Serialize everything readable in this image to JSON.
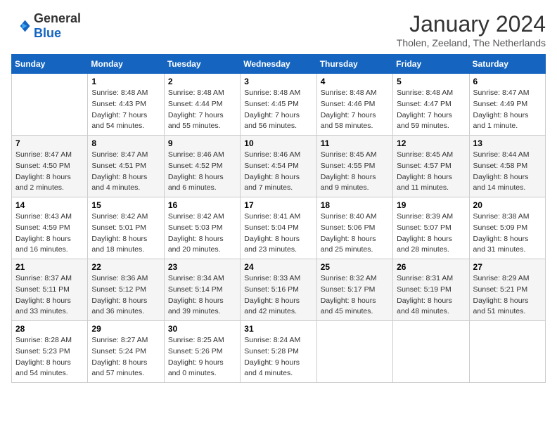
{
  "logo": {
    "text_general": "General",
    "text_blue": "Blue"
  },
  "header": {
    "month": "January 2024",
    "location": "Tholen, Zeeland, The Netherlands"
  },
  "weekdays": [
    "Sunday",
    "Monday",
    "Tuesday",
    "Wednesday",
    "Thursday",
    "Friday",
    "Saturday"
  ],
  "weeks": [
    [
      {
        "day": "",
        "sunrise": "",
        "sunset": "",
        "daylight": ""
      },
      {
        "day": "1",
        "sunrise": "Sunrise: 8:48 AM",
        "sunset": "Sunset: 4:43 PM",
        "daylight": "Daylight: 7 hours and 54 minutes."
      },
      {
        "day": "2",
        "sunrise": "Sunrise: 8:48 AM",
        "sunset": "Sunset: 4:44 PM",
        "daylight": "Daylight: 7 hours and 55 minutes."
      },
      {
        "day": "3",
        "sunrise": "Sunrise: 8:48 AM",
        "sunset": "Sunset: 4:45 PM",
        "daylight": "Daylight: 7 hours and 56 minutes."
      },
      {
        "day": "4",
        "sunrise": "Sunrise: 8:48 AM",
        "sunset": "Sunset: 4:46 PM",
        "daylight": "Daylight: 7 hours and 58 minutes."
      },
      {
        "day": "5",
        "sunrise": "Sunrise: 8:48 AM",
        "sunset": "Sunset: 4:47 PM",
        "daylight": "Daylight: 7 hours and 59 minutes."
      },
      {
        "day": "6",
        "sunrise": "Sunrise: 8:47 AM",
        "sunset": "Sunset: 4:49 PM",
        "daylight": "Daylight: 8 hours and 1 minute."
      }
    ],
    [
      {
        "day": "7",
        "sunrise": "Sunrise: 8:47 AM",
        "sunset": "Sunset: 4:50 PM",
        "daylight": "Daylight: 8 hours and 2 minutes."
      },
      {
        "day": "8",
        "sunrise": "Sunrise: 8:47 AM",
        "sunset": "Sunset: 4:51 PM",
        "daylight": "Daylight: 8 hours and 4 minutes."
      },
      {
        "day": "9",
        "sunrise": "Sunrise: 8:46 AM",
        "sunset": "Sunset: 4:52 PM",
        "daylight": "Daylight: 8 hours and 6 minutes."
      },
      {
        "day": "10",
        "sunrise": "Sunrise: 8:46 AM",
        "sunset": "Sunset: 4:54 PM",
        "daylight": "Daylight: 8 hours and 7 minutes."
      },
      {
        "day": "11",
        "sunrise": "Sunrise: 8:45 AM",
        "sunset": "Sunset: 4:55 PM",
        "daylight": "Daylight: 8 hours and 9 minutes."
      },
      {
        "day": "12",
        "sunrise": "Sunrise: 8:45 AM",
        "sunset": "Sunset: 4:57 PM",
        "daylight": "Daylight: 8 hours and 11 minutes."
      },
      {
        "day": "13",
        "sunrise": "Sunrise: 8:44 AM",
        "sunset": "Sunset: 4:58 PM",
        "daylight": "Daylight: 8 hours and 14 minutes."
      }
    ],
    [
      {
        "day": "14",
        "sunrise": "Sunrise: 8:43 AM",
        "sunset": "Sunset: 4:59 PM",
        "daylight": "Daylight: 8 hours and 16 minutes."
      },
      {
        "day": "15",
        "sunrise": "Sunrise: 8:42 AM",
        "sunset": "Sunset: 5:01 PM",
        "daylight": "Daylight: 8 hours and 18 minutes."
      },
      {
        "day": "16",
        "sunrise": "Sunrise: 8:42 AM",
        "sunset": "Sunset: 5:03 PM",
        "daylight": "Daylight: 8 hours and 20 minutes."
      },
      {
        "day": "17",
        "sunrise": "Sunrise: 8:41 AM",
        "sunset": "Sunset: 5:04 PM",
        "daylight": "Daylight: 8 hours and 23 minutes."
      },
      {
        "day": "18",
        "sunrise": "Sunrise: 8:40 AM",
        "sunset": "Sunset: 5:06 PM",
        "daylight": "Daylight: 8 hours and 25 minutes."
      },
      {
        "day": "19",
        "sunrise": "Sunrise: 8:39 AM",
        "sunset": "Sunset: 5:07 PM",
        "daylight": "Daylight: 8 hours and 28 minutes."
      },
      {
        "day": "20",
        "sunrise": "Sunrise: 8:38 AM",
        "sunset": "Sunset: 5:09 PM",
        "daylight": "Daylight: 8 hours and 31 minutes."
      }
    ],
    [
      {
        "day": "21",
        "sunrise": "Sunrise: 8:37 AM",
        "sunset": "Sunset: 5:11 PM",
        "daylight": "Daylight: 8 hours and 33 minutes."
      },
      {
        "day": "22",
        "sunrise": "Sunrise: 8:36 AM",
        "sunset": "Sunset: 5:12 PM",
        "daylight": "Daylight: 8 hours and 36 minutes."
      },
      {
        "day": "23",
        "sunrise": "Sunrise: 8:34 AM",
        "sunset": "Sunset: 5:14 PM",
        "daylight": "Daylight: 8 hours and 39 minutes."
      },
      {
        "day": "24",
        "sunrise": "Sunrise: 8:33 AM",
        "sunset": "Sunset: 5:16 PM",
        "daylight": "Daylight: 8 hours and 42 minutes."
      },
      {
        "day": "25",
        "sunrise": "Sunrise: 8:32 AM",
        "sunset": "Sunset: 5:17 PM",
        "daylight": "Daylight: 8 hours and 45 minutes."
      },
      {
        "day": "26",
        "sunrise": "Sunrise: 8:31 AM",
        "sunset": "Sunset: 5:19 PM",
        "daylight": "Daylight: 8 hours and 48 minutes."
      },
      {
        "day": "27",
        "sunrise": "Sunrise: 8:29 AM",
        "sunset": "Sunset: 5:21 PM",
        "daylight": "Daylight: 8 hours and 51 minutes."
      }
    ],
    [
      {
        "day": "28",
        "sunrise": "Sunrise: 8:28 AM",
        "sunset": "Sunset: 5:23 PM",
        "daylight": "Daylight: 8 hours and 54 minutes."
      },
      {
        "day": "29",
        "sunrise": "Sunrise: 8:27 AM",
        "sunset": "Sunset: 5:24 PM",
        "daylight": "Daylight: 8 hours and 57 minutes."
      },
      {
        "day": "30",
        "sunrise": "Sunrise: 8:25 AM",
        "sunset": "Sunset: 5:26 PM",
        "daylight": "Daylight: 9 hours and 0 minutes."
      },
      {
        "day": "31",
        "sunrise": "Sunrise: 8:24 AM",
        "sunset": "Sunset: 5:28 PM",
        "daylight": "Daylight: 9 hours and 4 minutes."
      },
      {
        "day": "",
        "sunrise": "",
        "sunset": "",
        "daylight": ""
      },
      {
        "day": "",
        "sunrise": "",
        "sunset": "",
        "daylight": ""
      },
      {
        "day": "",
        "sunrise": "",
        "sunset": "",
        "daylight": ""
      }
    ]
  ]
}
